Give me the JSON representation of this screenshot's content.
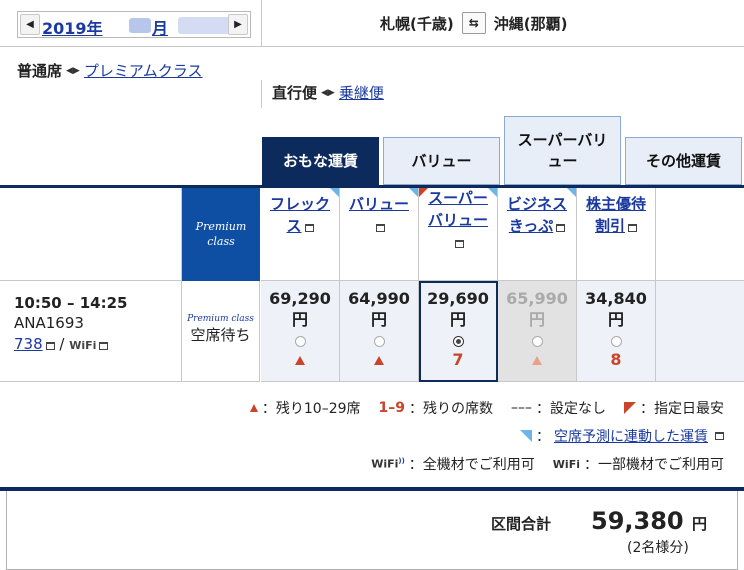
{
  "date": {
    "year": "2019年",
    "month": "月"
  },
  "route": {
    "origin": "札幌(千歳)",
    "destination": "沖縄(那覇)"
  },
  "cabin": {
    "selected": "普通席",
    "other": "プレミアムクラス"
  },
  "routing": {
    "selected": "直行便",
    "other": "乗継便"
  },
  "tabs": [
    "おもな運賃",
    "バリュー",
    "スーパーバリュー",
    "その他運賃"
  ],
  "fare_headers": [
    {
      "label": "フレックス"
    },
    {
      "label": "バリュー"
    },
    {
      "label": "スーパーバリュー"
    },
    {
      "label": "ビジネスきっぷ"
    },
    {
      "label": "株主優待割引"
    }
  ],
  "premium_class_label": "Premium class",
  "flight": {
    "time": "10:50 – 14:25",
    "number": "ANA1693",
    "aircraft": "738",
    "wifi": "WiFi",
    "premium_label": "Premium class",
    "premium_status": "空席待ち"
  },
  "fares": [
    {
      "price": "69,290",
      "unit": "円",
      "seats": "",
      "state": "available"
    },
    {
      "price": "64,990",
      "unit": "円",
      "seats": "",
      "state": "available"
    },
    {
      "price": "29,690",
      "unit": "円",
      "seats": "7",
      "state": "selected"
    },
    {
      "price": "65,990",
      "unit": "円",
      "seats": "",
      "state": "disabled"
    },
    {
      "price": "34,840",
      "unit": "円",
      "seats": "8",
      "state": "available"
    }
  ],
  "legend": {
    "few_seats": "：残り10–29席",
    "count_range": "1–9",
    "count_text": "：残りの席数",
    "not_set_mark": "–––",
    "not_set": "：設定なし",
    "lowest": "：指定日最安",
    "linked": "空席予測に連動した運賃",
    "wifi_all_logo": "WiFi",
    "wifi_all": "：全機材でご利用可",
    "wifi_some_logo": "WiFi",
    "wifi_some": "：一部機材でご利用可"
  },
  "total": {
    "label": "区間合計",
    "price": "59,380",
    "unit": "円",
    "pax": "(2名様分)"
  },
  "colors": {
    "navy": "#0d2a5c",
    "link": "#1a3aa0",
    "red": "#c8442b",
    "blue_flag": "#6cb5e6"
  }
}
